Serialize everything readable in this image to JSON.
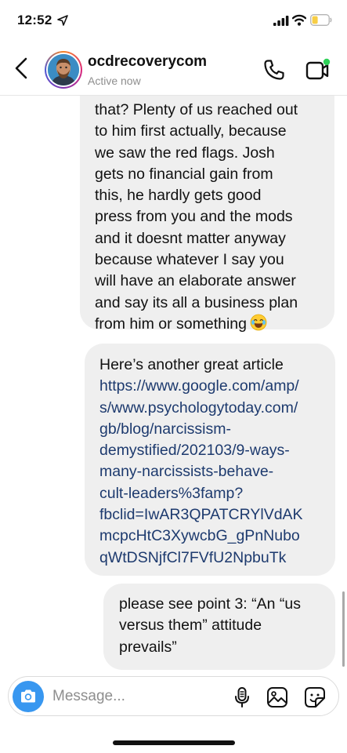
{
  "status_bar": {
    "time": "12:52",
    "icons": [
      "location-arrow-icon",
      "signal-icon",
      "wifi-icon",
      "battery-icon"
    ],
    "battery_color": "#f7ce46"
  },
  "header": {
    "name": "ocdrecoverycom",
    "status": "Active now",
    "icons": [
      "back-icon",
      "avatar",
      "phone-icon",
      "video-icon"
    ]
  },
  "messages": [
    {
      "sender": "incoming",
      "lines": [
        "that? Plenty of us reached out",
        "to him first actually, because",
        "we saw the red flags. Josh",
        "gets no financial gain from",
        "this, he hardly gets good",
        "press from you and the mods",
        "and it doesnt matter anyway",
        "because whatever I say you",
        "will have an elaborate answer",
        "and say its all a business plan",
        "from him or something"
      ],
      "emoji": "😂"
    },
    {
      "sender": "incoming",
      "intro": "Here’s another great article",
      "link_lines": [
        "https://www.google.com/amp/",
        "s/www.psychologytoday.com/",
        "gb/blog/narcissism-",
        "demystified/202103/9-ways-",
        "many-narcissists-behave-",
        "cult-leaders%3famp?",
        "fbclid=IwAR3QPATCRYlVdAK",
        "mcpcHtC3XywcbG_gPnNubo",
        "qWtDSNjfCl7FVfU2NpbuTk"
      ],
      "link_color": "#1d3a6e"
    },
    {
      "sender": "incoming",
      "lines": [
        "please see point 3: “An “us",
        "versus them” attitude",
        "prevails”"
      ]
    }
  ],
  "composer": {
    "placeholder": "Message...",
    "accent": "#3897f0",
    "icons": [
      "camera-icon",
      "microphone-icon",
      "gallery-icon",
      "sticker-icon"
    ]
  }
}
